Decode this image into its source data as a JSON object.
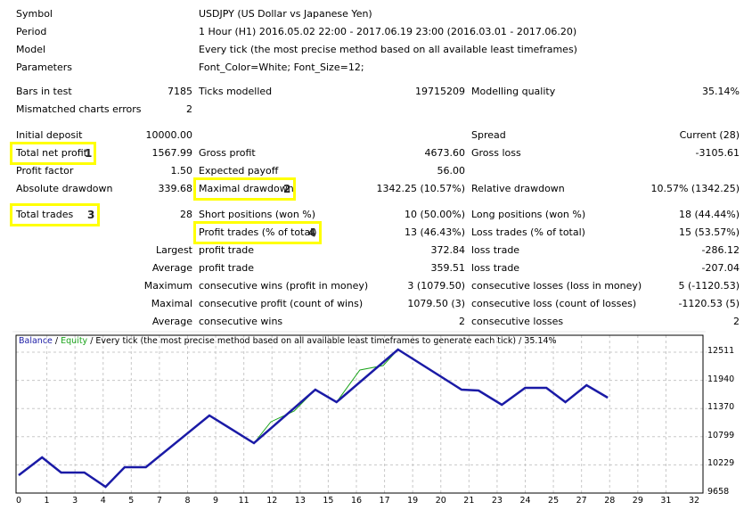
{
  "header": {
    "symbol": {
      "label": "Symbol",
      "value": "USDJPY (US Dollar vs Japanese Yen)"
    },
    "period": {
      "label": "Period",
      "value": "1 Hour (H1) 2016.05.02 22:00 - 2017.06.19 23:00 (2016.03.01 - 2017.06.20)"
    },
    "model": {
      "label": "Model",
      "value": "Every tick (the most precise method based on all available least timeframes)"
    },
    "parameters": {
      "label": "Parameters",
      "value": "Font_Color=White; Font_Size=12;"
    }
  },
  "test": {
    "bars_label": "Bars in test",
    "bars_value": "7185",
    "ticks_label": "Ticks modelled",
    "ticks_value": "19715209",
    "quality_label": "Modelling quality",
    "quality_value": "35.14%",
    "mismatch_label": "Mismatched charts errors",
    "mismatch_value": "2"
  },
  "results": {
    "initial_deposit_label": "Initial deposit",
    "initial_deposit_value": "10000.00",
    "spread_label": "Spread",
    "spread_value": "Current (28)",
    "net_profit_label": "Total net profit",
    "net_profit_value": "1567.99",
    "gross_profit_label": "Gross profit",
    "gross_profit_value": "4673.60",
    "gross_loss_label": "Gross loss",
    "gross_loss_value": "-3105.61",
    "profit_factor_label": "Profit factor",
    "profit_factor_value": "1.50",
    "expected_payoff_label": "Expected payoff",
    "expected_payoff_value": "56.00",
    "abs_dd_label": "Absolute drawdown",
    "abs_dd_value": "339.68",
    "max_dd_label": "Maximal drawdown",
    "max_dd_value": "1342.25 (10.57%)",
    "rel_dd_label": "Relative drawdown",
    "rel_dd_value": "10.57% (1342.25)",
    "total_trades_label": "Total trades",
    "total_trades_value": "28",
    "short_label": "Short positions (won %)",
    "short_value": "10 (50.00%)",
    "long_label": "Long positions (won %)",
    "long_value": "18 (44.44%)",
    "profit_trades_label": "Profit trades (% of total)",
    "profit_trades_value": "13 (46.43%)",
    "loss_trades_label": "Loss trades (% of total)",
    "loss_trades_value": "15 (53.57%)"
  },
  "stats": [
    {
      "prefix": "Largest",
      "label": "profit trade",
      "value": "372.84",
      "label2": "loss trade",
      "value2": "-286.12"
    },
    {
      "prefix": "Average",
      "label": "profit trade",
      "value": "359.51",
      "label2": "loss trade",
      "value2": "-207.04"
    },
    {
      "prefix": "Maximum",
      "label": "consecutive wins (profit in money)",
      "value": "3 (1079.50)",
      "label2": "consecutive losses (loss in money)",
      "value2": "5 (-1120.53)"
    },
    {
      "prefix": "Maximal",
      "label": "consecutive profit (count of wins)",
      "value": "1079.50 (3)",
      "label2": "consecutive loss (count of losses)",
      "value2": "-1120.53 (5)"
    },
    {
      "prefix": "Average",
      "label": "consecutive wins",
      "value": "2",
      "label2": "consecutive losses",
      "value2": "2"
    }
  ],
  "annotations": {
    "n1": "1",
    "n2": "2",
    "n3": "3",
    "n4": "4"
  },
  "chart": {
    "legend_balance": "Balance",
    "legend_sep1": " / ",
    "legend_equity": "Equity",
    "legend_rest": " / Every tick (the most precise method based on all available least timeframes to generate each tick) / 35.14%"
  },
  "colors": {
    "balance": "#1a1aa6",
    "equity": "#1aa31a",
    "highlight": "#ffff00",
    "grid": "#c8c8c8"
  },
  "chart_data": {
    "type": "line",
    "title": "Balance / Equity / Every tick (the most precise method based on all available least timeframes to generate each tick) / 35.14%",
    "xlabel": "",
    "ylabel": "",
    "xlim": [
      0,
      32
    ],
    "ylim": [
      9658,
      12511
    ],
    "x_tick_labels": [
      "0",
      "1",
      "3",
      "4",
      "5",
      "7",
      "8",
      "9",
      "11",
      "12",
      "13",
      "15",
      "16",
      "17",
      "19",
      "20",
      "21",
      "23",
      "24",
      "25",
      "27",
      "28",
      "29",
      "31",
      "32"
    ],
    "y_tick_labels": [
      "12511",
      "11940",
      "11370",
      "10799",
      "10229",
      "9658"
    ],
    "grid": true,
    "legend": "top-left",
    "series": [
      {
        "name": "Balance",
        "x": [
          0,
          1.1,
          2,
          3.1,
          4.1,
          5,
          6,
          9,
          11.1,
          14,
          15,
          17.9,
          20.9,
          21.7,
          22.8,
          23.9,
          24.9,
          25.8,
          26.8,
          27.8
        ],
        "values": [
          10019,
          10380,
          10073,
          10073,
          9784,
          10181,
          10181,
          11229,
          10669,
          11753,
          11500,
          12565,
          11753,
          11735,
          11446,
          11789,
          11789,
          11500,
          11843,
          11590
        ]
      },
      {
        "name": "Equity",
        "x": [
          0,
          1.1,
          2,
          3.1,
          4.1,
          5,
          6,
          9,
          11.1,
          11.9,
          13,
          14,
          15,
          16.1,
          17.2,
          17.9,
          20.9,
          21.7,
          22.8,
          23.9,
          24.9,
          25.8,
          26.8,
          27.8
        ],
        "values": [
          10019,
          10380,
          10073,
          10073,
          9784,
          10181,
          10181,
          11229,
          10669,
          11100,
          11320,
          11753,
          11500,
          12150,
          12240,
          12565,
          11753,
          11735,
          11446,
          11789,
          11789,
          11500,
          11843,
          11590
        ]
      }
    ]
  }
}
